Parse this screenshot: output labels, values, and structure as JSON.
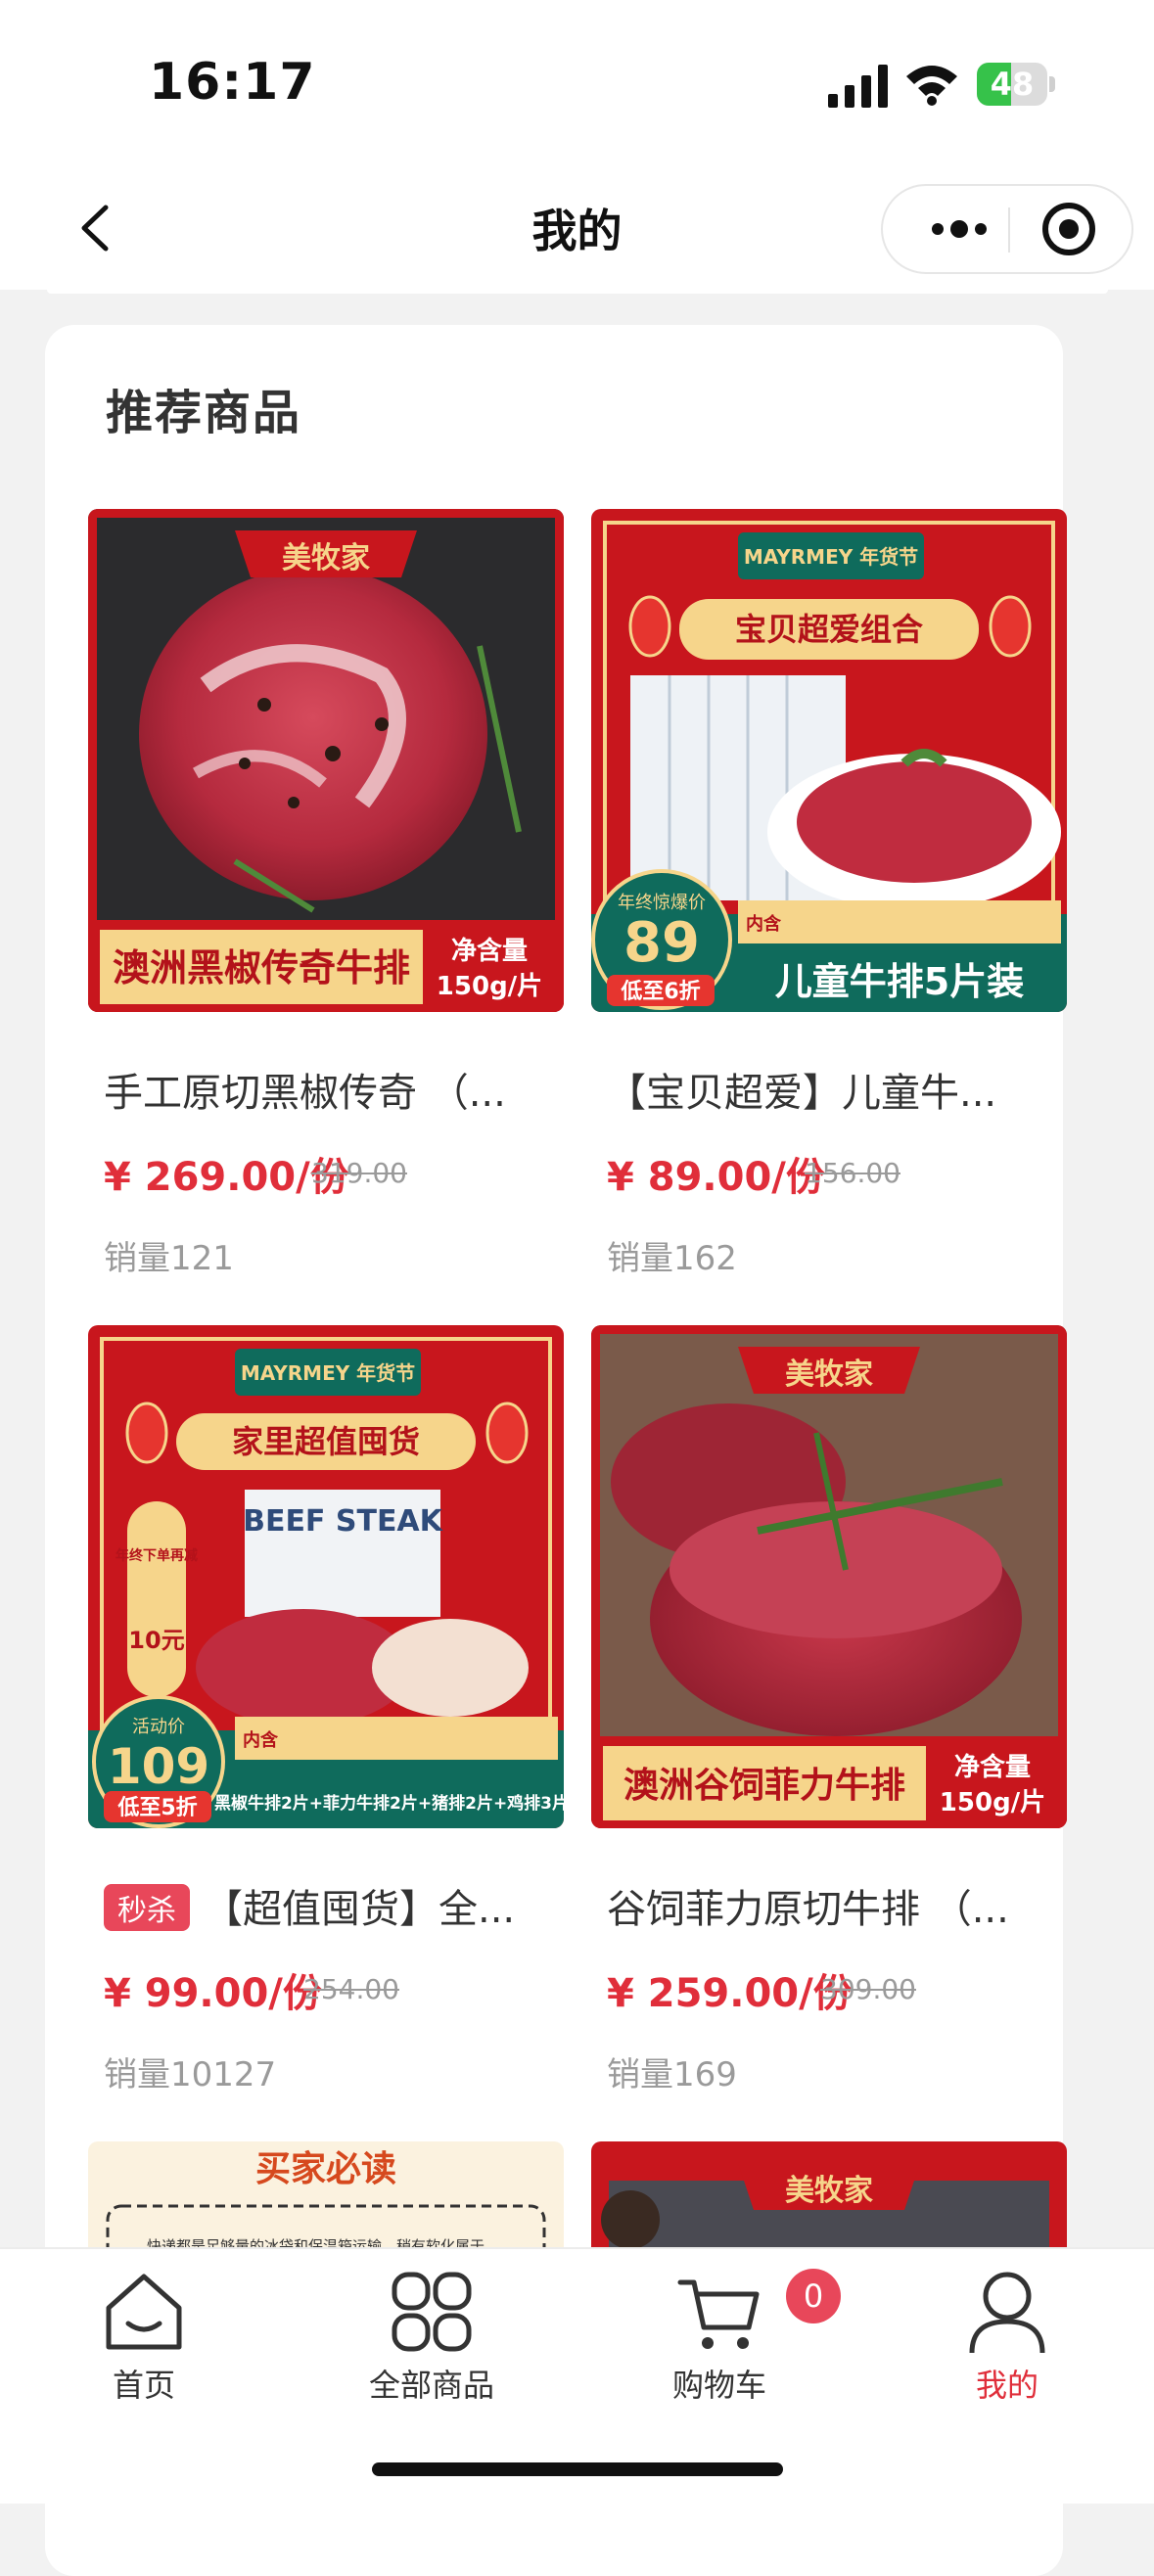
{
  "status_bar": {
    "time": "16:17",
    "battery": "48",
    "battery_level": 0.48
  },
  "nav": {
    "title": "我的"
  },
  "section": {
    "title": "推荐商品"
  },
  "products": [
    {
      "name": "手工原切黑椒传奇 （...",
      "price": "¥ 269.00/份",
      "original_price": "319.00",
      "sales": "销量121",
      "img": {
        "brand": "美牧家",
        "banner": "澳洲黑椒传奇牛排",
        "net_label": "净含量",
        "net_value": "150g/片"
      }
    },
    {
      "name": "【宝贝超爱】儿童牛...",
      "price": "¥ 89.00/份",
      "original_price": "156.00",
      "sales": "销量162",
      "img": {
        "brand": "MAYRMEY 年货节",
        "headline": "宝贝超爱组合",
        "price_label": "年终惊爆价",
        "price": "89",
        "discount": "低至6折",
        "banner": "儿童牛排5片装",
        "pack_label": "内含"
      }
    },
    {
      "tag": "秒杀",
      "name": "【超值囤货】全...",
      "price": "¥ 99.00/份",
      "original_price": "254.00",
      "sales": "销量10127",
      "img": {
        "brand": "MAYRMEY 年货节",
        "headline": "家里超值囤货",
        "side_label": "年终下单再减",
        "side_value": "10元",
        "price_label": "活动价",
        "price": "109",
        "discount": "低至5折",
        "bottom": "黑椒牛排2片+菲力牛排2片+猪排2片+鸡排3片",
        "pack_label": "内含",
        "pack_text": "BEEF STEAK"
      }
    },
    {
      "name": "谷饲菲力原切牛排 （...",
      "price": "¥ 259.00/份",
      "original_price": "309.00",
      "sales": "销量169",
      "img": {
        "brand": "美牧家",
        "banner": "澳洲谷饲菲力牛排",
        "net_label": "净含量",
        "net_value": "150g/片"
      }
    }
  ],
  "partial": {
    "left_title": "买家必读",
    "left_text": "快递都是足够量的冰袋和保温箱运输，稍有软化属于",
    "right_brand": "美牧家"
  },
  "tabs": [
    {
      "label": "首页",
      "icon": "home-icon"
    },
    {
      "label": "全部商品",
      "icon": "grid-icon"
    },
    {
      "label": "购物车",
      "icon": "cart-icon",
      "badge": "0"
    },
    {
      "label": "我的",
      "icon": "user-icon",
      "active": true
    }
  ],
  "colors": {
    "accent": "#e02e3a",
    "badge": "#e8475a",
    "banner_red": "#c8161d",
    "gold": "#f6d58b"
  }
}
